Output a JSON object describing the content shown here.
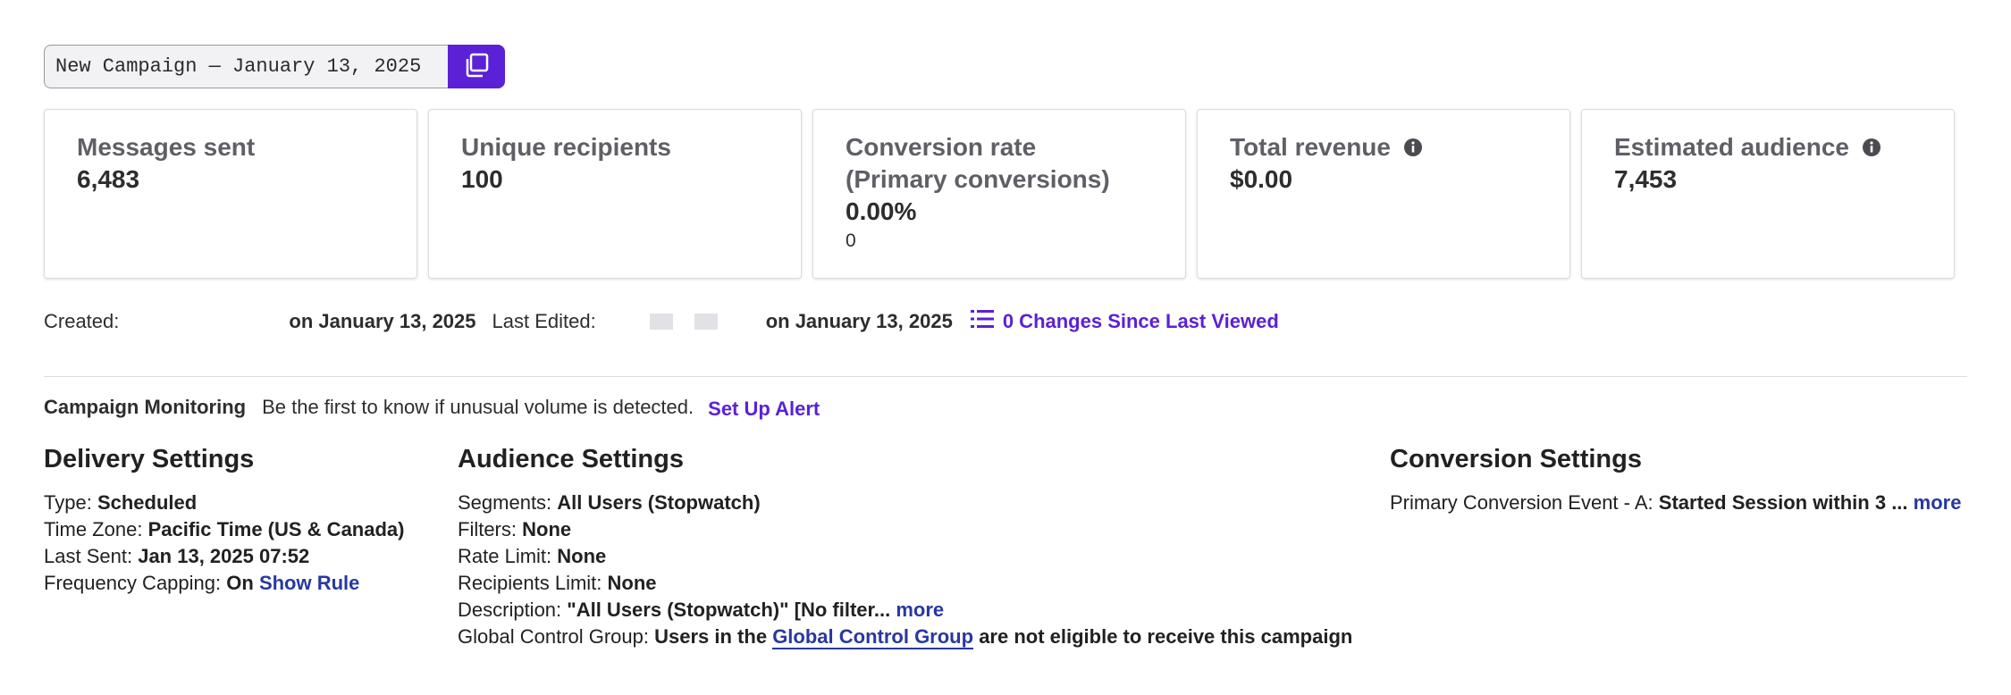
{
  "campaign": {
    "name": "New Campaign — January 13, 2025"
  },
  "colors": {
    "accent": "#5b21d6",
    "link": "#2838a0"
  },
  "stats": [
    {
      "label": "Messages sent",
      "value": "6,483"
    },
    {
      "label": "Unique recipients",
      "value": "100"
    },
    {
      "label": "Conversion rate\n(Primary conversions)",
      "label_line1": "Conversion rate",
      "label_line2": "(Primary conversions)",
      "value": "0.00%",
      "sub": "0"
    },
    {
      "label": "Total revenue",
      "value": "$0.00",
      "icon": "info-icon"
    },
    {
      "label": "Estimated audience",
      "value": "7,453",
      "icon": "info-icon"
    }
  ],
  "meta": {
    "created_label": "Created:",
    "created_date": "on January 13, 2025",
    "edited_label": "Last Edited:",
    "edited_date": "on January 13, 2025",
    "changes_link": "0 Changes Since Last Viewed",
    "changes_icon": "list-icon"
  },
  "monitoring": {
    "title": "Campaign Monitoring",
    "text": "Be the first to know if unusual volume is detected.",
    "link": "Set Up Alert"
  },
  "delivery": {
    "title": "Delivery Settings",
    "type_label": "Type:",
    "type_value": "Scheduled",
    "timezone_label": "Time Zone:",
    "timezone_value": "Pacific Time (US & Canada)",
    "last_sent_label": "Last Sent:",
    "last_sent_value": "Jan 13, 2025 07:52",
    "capping_label": "Frequency Capping:",
    "capping_value": "On",
    "capping_link": "Show Rule"
  },
  "audience": {
    "title": "Audience Settings",
    "segments_label": "Segments:",
    "segments_value": "All Users (Stopwatch)",
    "filters_label": "Filters:",
    "filters_value": "None",
    "rate_label": "Rate Limit:",
    "rate_value": "None",
    "recipients_label": "Recipients Limit:",
    "recipients_value": "None",
    "description_label": "Description:",
    "description_value": "\"All Users (Stopwatch)\" [No filter...",
    "description_more": "more",
    "gcg_label": "Global Control Group:",
    "gcg_prefix": "Users in the",
    "gcg_link": "Global Control Group",
    "gcg_suffix": "are not eligible to receive this campaign"
  },
  "conversion": {
    "title": "Conversion Settings",
    "event_label": "Primary Conversion Event - A:",
    "event_value": "Started Session within 3 ...",
    "event_more": "more"
  }
}
